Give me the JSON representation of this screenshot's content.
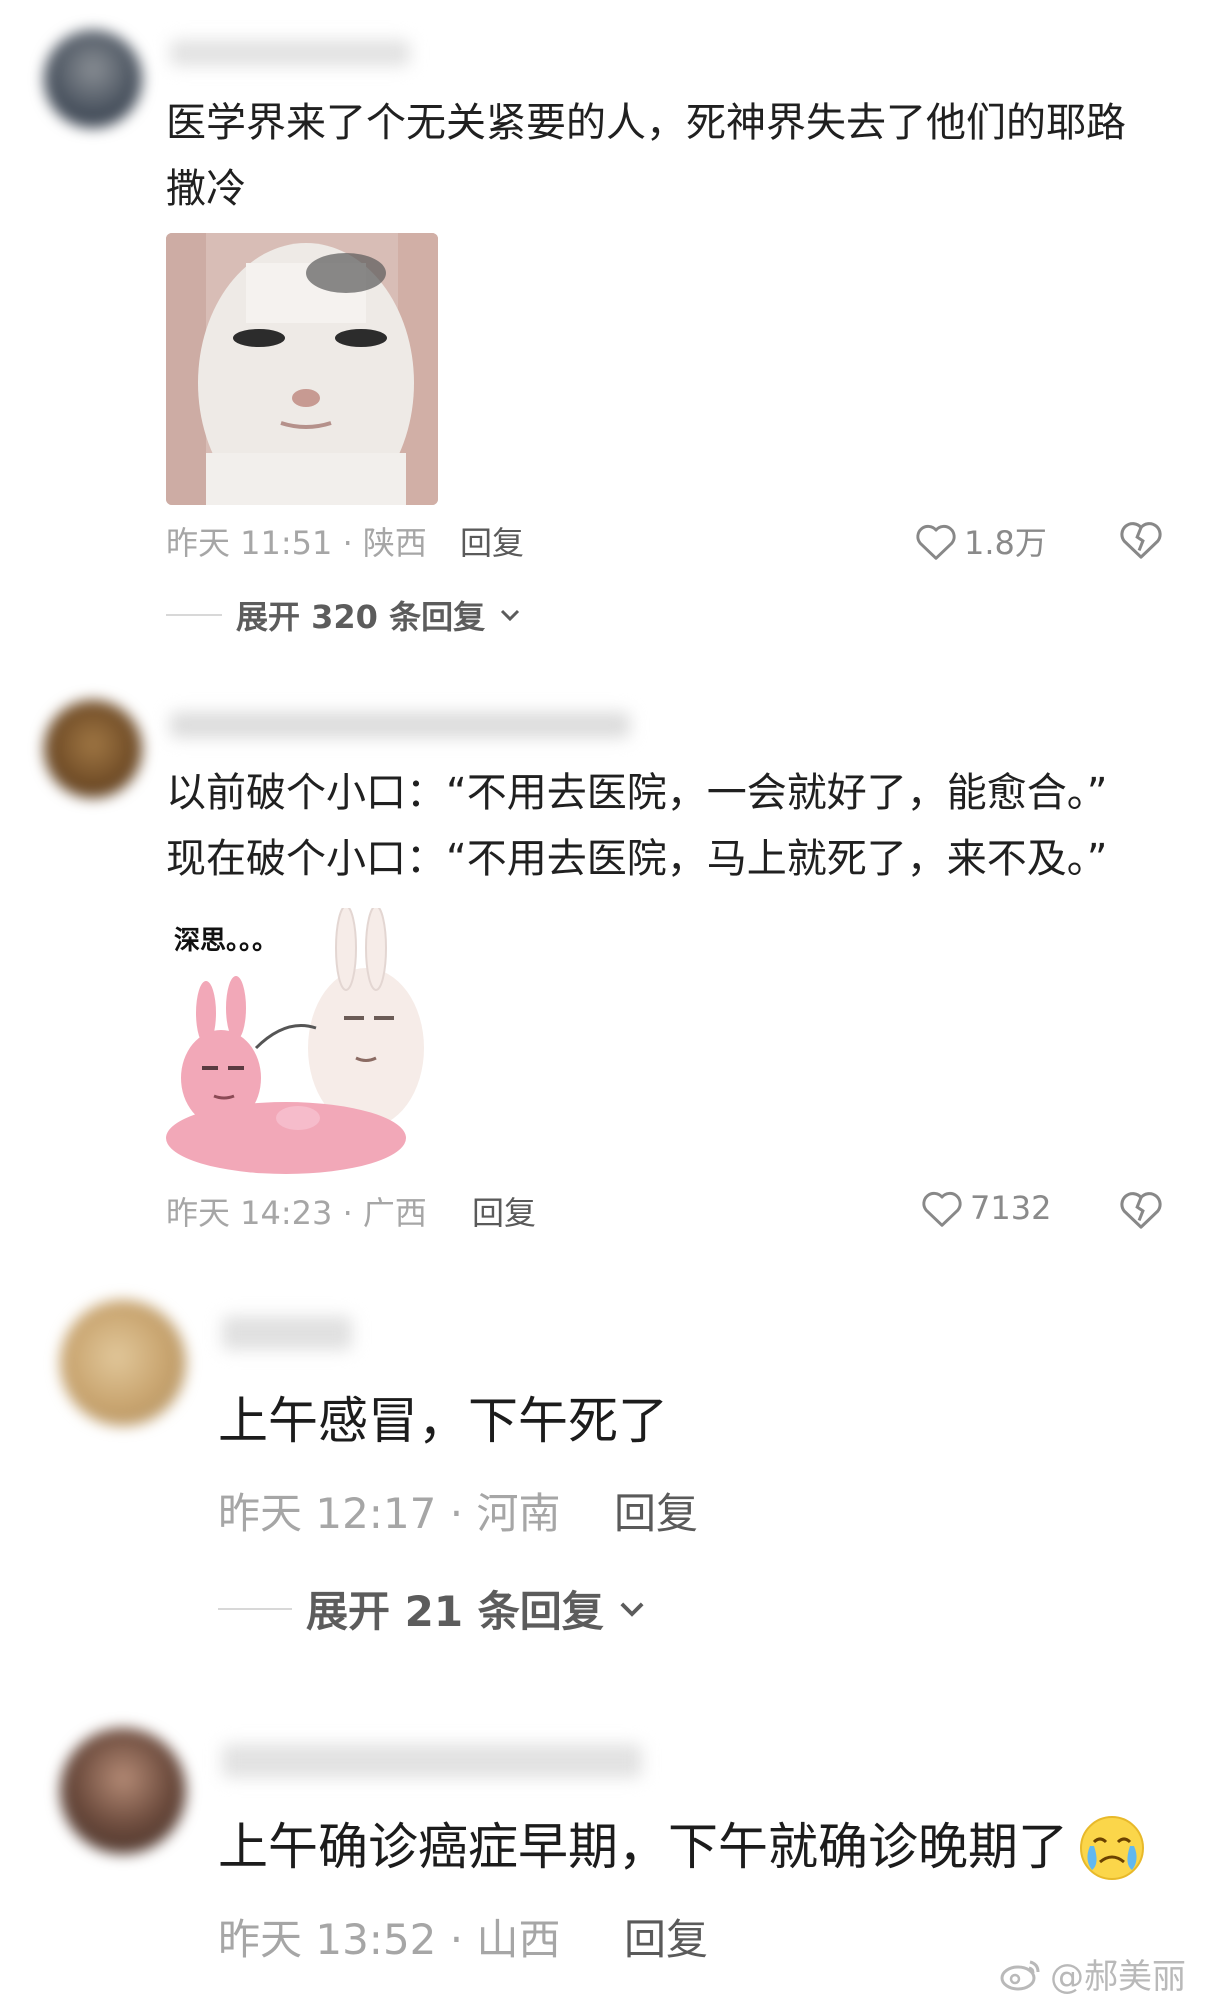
{
  "comments": [
    {
      "text": "医学界来了个无关紧要的人，死神界失去了他们的耶路撒冷",
      "time": "昨天 11:51 · 陕西",
      "reply": "回复",
      "likes": "1.8万",
      "expand": "展开 320 条回复"
    },
    {
      "text": "以前破个小口：“不用去医院，一会就好了，能愈合。”\n现在破个小口：“不用去医院，马上就死了，来不及。”",
      "sticker_caption": "深思。。。",
      "time": "昨天 14:23 · 广西",
      "reply": "回复",
      "likes": "7132"
    },
    {
      "text": "上午感冒，下午死了",
      "time": "昨天 12:17 · 河南",
      "reply": "回复",
      "expand": "展开 21 条回复"
    },
    {
      "text": "上午确诊癌症早期，下午就确诊晚期了",
      "time": "昨天 13:52 · 山西",
      "reply": "回复"
    }
  ],
  "watermark": "@郝美丽",
  "icons": {
    "like": "heart-outline-icon",
    "dislike": "broken-heart-icon",
    "expand": "chevron-down-icon",
    "emoji": "crying-face-emoji",
    "watermark": "weibo-logo-icon"
  }
}
